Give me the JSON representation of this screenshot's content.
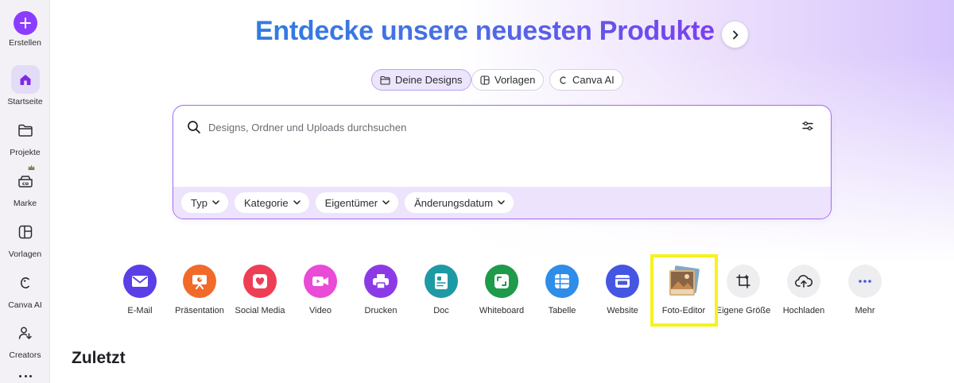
{
  "sidebar": {
    "items": [
      {
        "label": "Erstellen",
        "icon": "plus-icon"
      },
      {
        "label": "Startseite",
        "icon": "home-icon"
      },
      {
        "label": "Projekte",
        "icon": "folder-icon"
      },
      {
        "label": "Marke",
        "icon": "brand-icon"
      },
      {
        "label": "Vorlagen",
        "icon": "templates-icon"
      },
      {
        "label": "Canva AI",
        "icon": "canva-ai-icon"
      },
      {
        "label": "Creators",
        "icon": "creators-icon"
      }
    ],
    "active": "Startseite"
  },
  "hero": {
    "title": "Entdecke unsere neuesten Produkte"
  },
  "tabs": [
    {
      "label": "Deine Designs",
      "icon": "folder-icon",
      "active": true
    },
    {
      "label": "Vorlagen",
      "icon": "templates-icon",
      "active": false
    },
    {
      "label": "Canva AI",
      "icon": "canva-ai-icon",
      "active": false
    }
  ],
  "search": {
    "placeholder": "Designs, Ordner und Uploads durchsuchen",
    "filters": [
      "Typ",
      "Kategorie",
      "Eigentümer",
      "Änderungsdatum"
    ]
  },
  "shortcuts": [
    {
      "label": "E-Mail",
      "icon": "email-icon",
      "color": "#5a3ee6"
    },
    {
      "label": "Präsentation",
      "icon": "presentation-icon",
      "color": "#f26a2a"
    },
    {
      "label": "Social Media",
      "icon": "social-media-icon",
      "color": "#ee3e55"
    },
    {
      "label": "Video",
      "icon": "video-icon",
      "color": "#e94ad6"
    },
    {
      "label": "Drucken",
      "icon": "print-icon",
      "color": "#8c3ae6"
    },
    {
      "label": "Doc",
      "icon": "doc-icon",
      "color": "#1e9aa5"
    },
    {
      "label": "Whiteboard",
      "icon": "whiteboard-icon",
      "color": "#1f9a4a"
    },
    {
      "label": "Tabelle",
      "icon": "table-icon",
      "color": "#2d8de8"
    },
    {
      "label": "Website",
      "icon": "website-icon",
      "color": "#4556e3"
    },
    {
      "label": "Foto-Editor",
      "icon": "photo-editor-icon",
      "color": "#c98b4a"
    },
    {
      "label": "Eigene Größe",
      "icon": "custom-size-icon",
      "color": "#eeeef0"
    },
    {
      "label": "Hochladen",
      "icon": "upload-icon",
      "color": "#eeeef0"
    },
    {
      "label": "Mehr",
      "icon": "more-icon",
      "color": "#eeeef0"
    }
  ],
  "highlighted_shortcut": "Foto-Editor",
  "recent": {
    "title": "Zuletzt"
  },
  "colors": {
    "accent": "#8b3dff",
    "highlight": "#f6f31b"
  }
}
